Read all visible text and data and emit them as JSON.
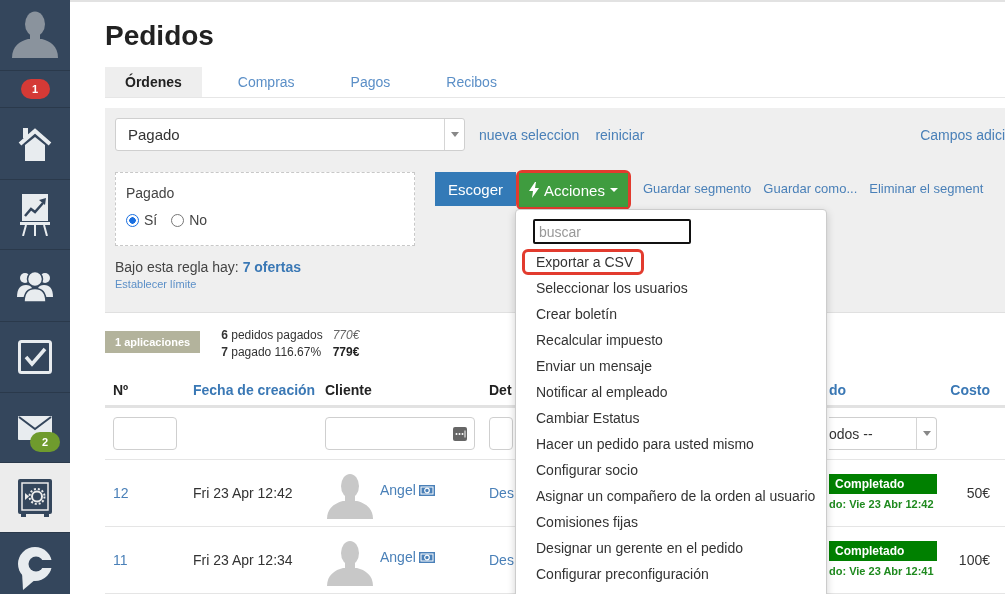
{
  "sidebar": {
    "items": [
      {
        "kind": "profile",
        "selected": false
      },
      {
        "kind": "notifications",
        "selected": false,
        "badge": {
          "text": "1",
          "color": "#d43a36"
        }
      },
      {
        "kind": "home",
        "selected": false
      },
      {
        "kind": "reports",
        "selected": false
      },
      {
        "kind": "team",
        "selected": false
      },
      {
        "kind": "tasks",
        "selected": false
      },
      {
        "kind": "messages",
        "selected": false,
        "badge": {
          "text": "2",
          "color": "#6f9b2d"
        }
      },
      {
        "kind": "safe",
        "selected": true
      },
      {
        "kind": "chat",
        "selected": false
      }
    ]
  },
  "page": {
    "title": "Pedidos"
  },
  "tabs": [
    {
      "label": "Órdenes",
      "selected": true
    },
    {
      "label": "Compras",
      "selected": false
    },
    {
      "label": "Pagos",
      "selected": false
    },
    {
      "label": "Recibos",
      "selected": false
    }
  ],
  "filter": {
    "segment_select": {
      "value": "Pagado"
    },
    "links": [
      "nueva seleccion",
      "reiniciar"
    ],
    "extra_fields_link": "Campos adici",
    "condition": {
      "label": "Pagado",
      "options": [
        {
          "label": "Sí",
          "selected": true
        },
        {
          "label": "No",
          "selected": false
        }
      ]
    },
    "rule_summary": "Bajo esta regla hay: **7 ofertas**",
    "limit_link": "Establecer límite",
    "choose_button": "Escoger",
    "actions_button": {
      "label": "Acciones",
      "highlighted": true
    },
    "segment_links": [
      "Guardar segmento",
      "Guardar como...",
      "Eliminar el segment"
    ]
  },
  "actions_menu": {
    "search": {
      "placeholder": "buscar"
    },
    "items": [
      {
        "label": "Exportar a CSV",
        "highlighted": true
      },
      {
        "label": "Seleccionar los usuarios",
        "highlighted": false
      },
      {
        "label": "Crear boletín",
        "highlighted": false
      },
      {
        "label": "Recalcular impuesto",
        "highlighted": false
      },
      {
        "label": "Enviar un mensaje",
        "highlighted": false
      },
      {
        "label": "Notificar al empleado",
        "highlighted": false
      },
      {
        "label": "Cambiar Estatus",
        "highlighted": false
      },
      {
        "label": "Hacer un pedido para usted mismo",
        "highlighted": false
      },
      {
        "label": "Configurar socio",
        "highlighted": false
      },
      {
        "label": "Asignar un compañero de la orden al usuario",
        "highlighted": false
      },
      {
        "label": "Comisiones fijas",
        "highlighted": false
      },
      {
        "label": "Designar un gerente en el pedido",
        "highlighted": false
      },
      {
        "label": "Configurar preconfiguración",
        "highlighted": false
      }
    ]
  },
  "summary": {
    "applications_badge": "1 aplicaciones",
    "lines": [
      {
        "text": "**6** pedidos pagados",
        "amount": "770€",
        "kind": "expected"
      },
      {
        "text": "**7** pagado 116.67%",
        "amount": "779€",
        "kind": "paid"
      }
    ]
  },
  "table": {
    "columns": [
      {
        "label": "Nº",
        "sortable": false,
        "filter": {
          "kind": "text"
        }
      },
      {
        "label": "Fecha de creación",
        "sortable": true
      },
      {
        "label": "Cliente",
        "sortable": false,
        "filter": {
          "kind": "lookup"
        }
      },
      {
        "label": "Det",
        "sortable": false,
        "filter": {
          "kind": "text"
        }
      },
      {
        "label": "do",
        "sortable": true,
        "filter": {
          "kind": "select",
          "value": "odos --"
        }
      },
      {
        "label": "Costo",
        "sortable": true
      }
    ],
    "rows": [
      {
        "number": "12",
        "created": "Fri 23 Apr 12:42",
        "client": "Angel",
        "detail": "Des",
        "status": "Completado",
        "status_note": "do: Vie 23 Abr 12:42",
        "cost": "50€"
      },
      {
        "number": "11",
        "created": "Fri 23 Apr 12:34",
        "client": "Angel",
        "detail": "Des",
        "status": "Completado",
        "status_note": "do: Vie 23 Abr 12:41",
        "cost": "100€"
      }
    ]
  }
}
